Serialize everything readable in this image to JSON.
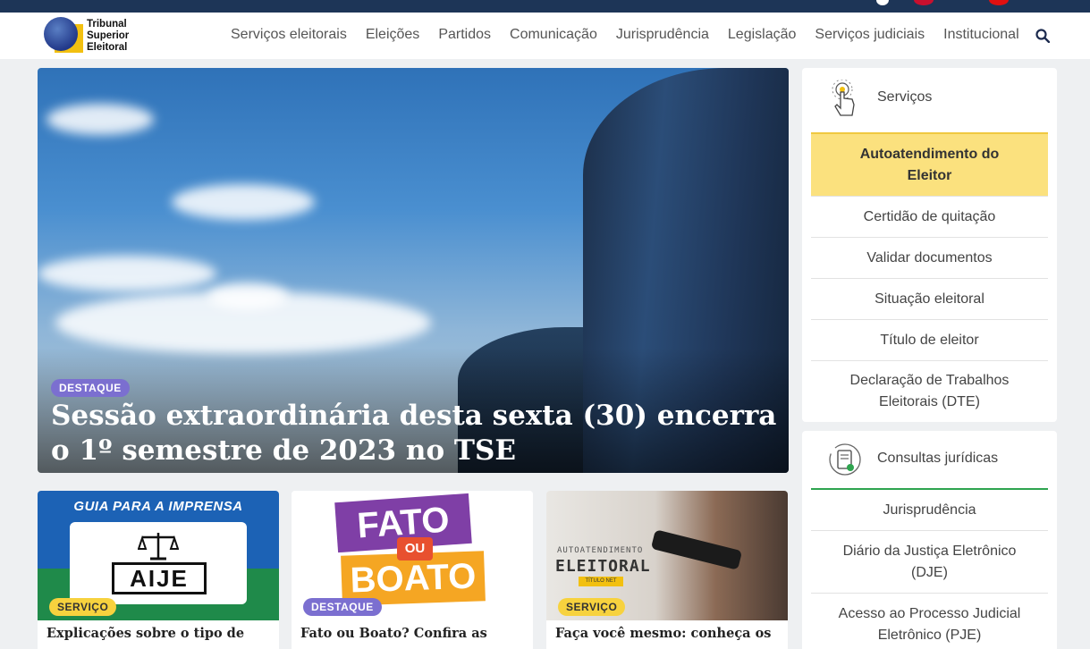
{
  "header": {
    "logo_lines": [
      "Tribunal",
      "Superior",
      "Eleitoral"
    ],
    "nav": [
      "Serviços eleitorais",
      "Eleições",
      "Partidos",
      "Comunicação",
      "Jurisprudência",
      "Legislação",
      "Serviços judiciais",
      "Institucional"
    ],
    "search_icon": "search-icon"
  },
  "hero": {
    "badge": "DESTAQUE",
    "title": "Sessão extraordinária desta sexta (30) encerra o 1º semestre de 2023 no TSE"
  },
  "cards": [
    {
      "badge": "SERVIÇO",
      "title": "Explicações sobre o tipo de",
      "thumb_heading": "GUIA PARA A IMPRENSA",
      "thumb_word": "AIJE"
    },
    {
      "badge": "DESTAQUE",
      "title": "Fato ou Boato? Confira as",
      "thumb_top": "FATO",
      "thumb_mid": "OU",
      "thumb_bottom": "BOATO"
    },
    {
      "badge": "SERVIÇO",
      "title": "Faça você mesmo: conheça os",
      "thumb_small": "AUTOATENDIMENTO",
      "thumb_big": "ELEITORAL",
      "thumb_tag": "TÍTULO NET"
    }
  ],
  "services": {
    "title": "Serviços",
    "items": [
      "Autoatendimento do Eleitor",
      "Certidão de quitação",
      "Validar documentos",
      "Situação eleitoral",
      "Título de eleitor",
      "Declaração de Trabalhos Eleitorais (DTE)"
    ]
  },
  "consultas": {
    "title": "Consultas jurídicas",
    "items": [
      "Jurisprudência",
      "Diário da Justiça Eletrônico (DJE)",
      "Acesso ao Processo Judicial Eletrônico (PJE)"
    ]
  },
  "colors": {
    "top_strip": "#1d3557",
    "highlight": "#fbe17e",
    "badge_purple": "#7b6fd0",
    "badge_yellow": "#f7d23e",
    "consultas_underline": "#2ea44f"
  }
}
